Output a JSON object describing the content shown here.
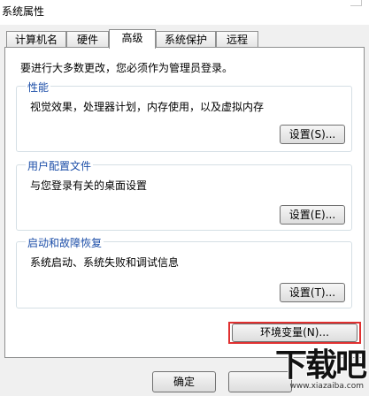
{
  "window": {
    "title": "系统属性"
  },
  "tabs": [
    {
      "label": "计算机名",
      "active": false
    },
    {
      "label": "硬件",
      "active": false
    },
    {
      "label": "高级",
      "active": true
    },
    {
      "label": "系统保护",
      "active": false
    },
    {
      "label": "远程",
      "active": false
    }
  ],
  "intro": "要进行大多数更改，您必须作为管理员登录。",
  "groups": {
    "performance": {
      "title": "性能",
      "description": "视觉效果，处理器计划，内存使用，以及虚拟内存",
      "button": "设置(S)..."
    },
    "user_profiles": {
      "title": "用户配置文件",
      "description": "与您登录有关的桌面设置",
      "button": "设置(E)..."
    },
    "startup_recovery": {
      "title": "启动和故障恢复",
      "description": "系统启动、系统失败和调试信息",
      "button": "设置(T)..."
    }
  },
  "env_button": "环境变量(N)...",
  "footer": {
    "ok": "确定"
  },
  "watermark": {
    "brand": "下载吧",
    "url": "www.xiazaiba.com"
  },
  "colors": {
    "group_title": "#1c4ea8",
    "highlight": "#e03030"
  }
}
